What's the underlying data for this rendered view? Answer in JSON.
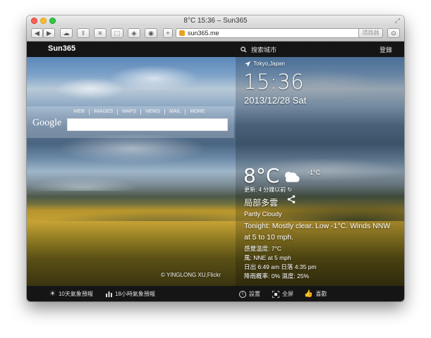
{
  "window": {
    "title": "8°C 15:36 – Sun365"
  },
  "browser": {
    "url": "sun365.me",
    "go_label": "環路器"
  },
  "site": {
    "brand": "Sun365",
    "search_placeholder": "搜索城市",
    "login": "登錄"
  },
  "google": {
    "logo": "Google",
    "links": [
      "WEB",
      "IMAGES",
      "MAPS",
      "NEWS",
      "MAIL",
      "MORE"
    ]
  },
  "photo": {
    "credit": "© YINGLONG XU,Flickr"
  },
  "weather": {
    "location": "Tokyo,Japan",
    "time": "15:36",
    "date": "2013/12/28 Sat",
    "temp": "8°C",
    "low": "-1°C",
    "updated": "更新: 4 分鐘以前",
    "condition_cn": "局部多雲",
    "condition_en": "Partly Cloudy",
    "tonight": "Tonight: Mostly clear. Low -1°C. Winds NNW at 5 to 10 mph.",
    "feels": "感覺溫度: 7°C",
    "wind": "風: NNE at 5 mph",
    "sun": "日出 6:49 am 日落 4:35 pm",
    "rain": "降雨概率: 0% 濕度: 25%"
  },
  "bottom": {
    "forecast10": "10天氣象預報",
    "forecast18": "18小時氣象預報",
    "settings": "設置",
    "fullscreen": "全屏",
    "like": "喜歡"
  }
}
